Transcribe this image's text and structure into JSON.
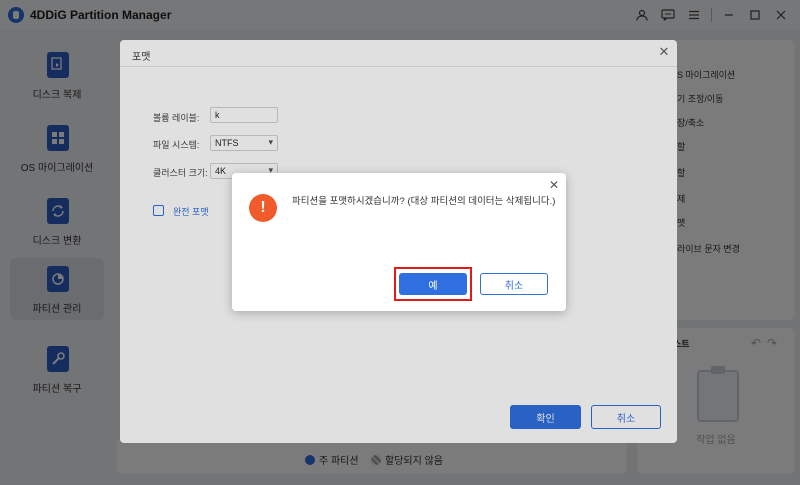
{
  "app": {
    "title": "4DDiG Partition Manager",
    "window_controls": [
      "user-icon",
      "feedback-icon",
      "menu-icon",
      "minimize-icon",
      "maximize-icon",
      "close-icon"
    ]
  },
  "sidebar": {
    "items": [
      {
        "label": "디스크 복제",
        "icon": "disk-clone-icon",
        "active": false
      },
      {
        "label": "OS 마이그레이션",
        "icon": "os-migration-icon",
        "active": false
      },
      {
        "label": "디스크 변환",
        "icon": "disk-convert-icon",
        "active": false
      },
      {
        "label": "파티션 관리",
        "icon": "partition-manage-icon",
        "active": true
      },
      {
        "label": "파티션 복구",
        "icon": "partition-recovery-icon",
        "active": false
      }
    ]
  },
  "right_panel": {
    "items": [
      "S 마이그레이션",
      "기 조정/이동",
      "장/축소",
      "할",
      "할",
      "제",
      "맷",
      "라이브 문자 변경"
    ]
  },
  "task_panel": {
    "title": "스트",
    "empty_text": "작업 없음"
  },
  "legend": {
    "primary": "주 파티션",
    "unallocated": "할당되지 않음"
  },
  "format_dialog": {
    "title": "포맷",
    "volume_label_label": "볼륨 레이블:",
    "volume_label_value": "k",
    "fs_label": "파일 시스템:",
    "fs_value": "NTFS",
    "cluster_label": "클러스터 크기:",
    "cluster_value": "4K",
    "full_format_label": "완전 포맷",
    "ok_label": "확인",
    "cancel_label": "취소"
  },
  "confirm_dialog": {
    "message": "파티션을 포맷하시겠습니까? (대상 파티션의 데이터는 삭제됩니다.)",
    "yes_label": "예",
    "cancel_label": "취소"
  },
  "colors": {
    "accent": "#2f6fe0",
    "warning": "#f15a2b",
    "highlight": "#e01a1a"
  }
}
